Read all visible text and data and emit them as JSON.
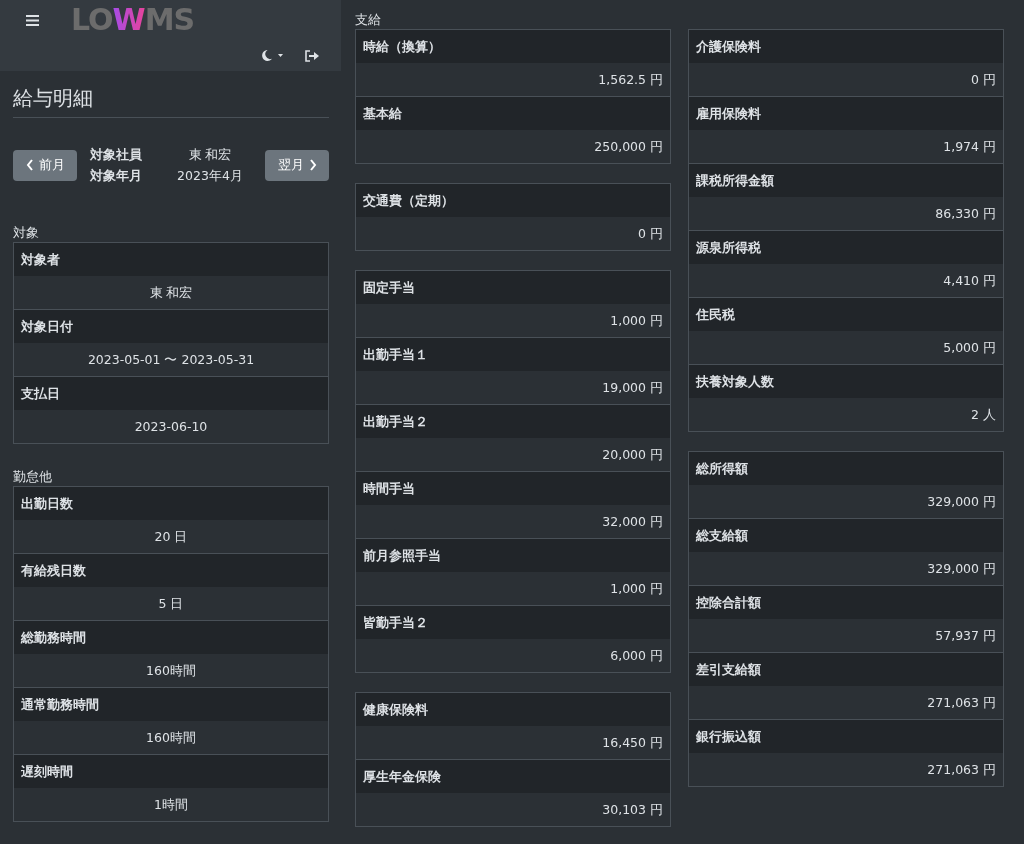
{
  "header": {
    "logo": [
      {
        "text": "LO",
        "kind": "plain"
      },
      {
        "text": "W",
        "kind": "accent"
      },
      {
        "text": "MS",
        "kind": "plain"
      }
    ]
  },
  "page": {
    "title": "給与明細",
    "prev_button": "前月",
    "next_button": "翌月",
    "meta": [
      {
        "label": "対象社員",
        "value": "東 和宏"
      },
      {
        "label": "対象年月",
        "value": "2023年4月"
      }
    ]
  },
  "columns": [
    {
      "kind": "centered",
      "sections": [
        {
          "heading": "対象",
          "boxes": [
            [
              {
                "label": "対象者",
                "value": "東 和宏"
              },
              {
                "label": "対象日付",
                "value": "2023-05-01 〜 2023-05-31"
              },
              {
                "label": "支払日",
                "value": "2023-06-10"
              }
            ]
          ]
        },
        {
          "heading": "勤怠他",
          "boxes": [
            [
              {
                "label": "出勤日数",
                "value": "20 日"
              },
              {
                "label": "有給残日数",
                "value": "5 日"
              },
              {
                "label": "総勤務時間",
                "value": "160時間"
              },
              {
                "label": "通常勤務時間",
                "value": "160時間"
              },
              {
                "label": "遅刻時間",
                "value": "1時間"
              }
            ]
          ]
        }
      ]
    },
    {
      "kind": "amounts",
      "sections": [
        {
          "heading": "支給",
          "boxes": [
            [
              {
                "label": "時給（換算）",
                "value": "1,562.5 円"
              },
              {
                "label": "基本給",
                "value": "250,000 円"
              }
            ],
            [
              {
                "label": "交通費（定期）",
                "value": "0 円"
              }
            ],
            [
              {
                "label": "固定手当",
                "value": "1,000 円"
              },
              {
                "label": "出勤手当１",
                "value": "19,000 円"
              },
              {
                "label": "出勤手当２",
                "value": "20,000 円"
              },
              {
                "label": "時間手当",
                "value": "32,000 円"
              },
              {
                "label": "前月参照手当",
                "value": "1,000 円"
              },
              {
                "label": "皆勤手当２",
                "value": "6,000 円"
              }
            ],
            [
              {
                "label": "健康保険料",
                "value": "16,450 円"
              },
              {
                "label": "厚生年金保険",
                "value": "30,103 円"
              }
            ]
          ]
        }
      ]
    },
    {
      "kind": "amounts",
      "sections": [
        {
          "boxes": [
            [
              {
                "label": "介護保険料",
                "value": "0 円"
              },
              {
                "label": "雇用保険料",
                "value": "1,974 円"
              },
              {
                "label": "課税所得金額",
                "value": "86,330 円"
              },
              {
                "label": "源泉所得税",
                "value": "4,410 円"
              },
              {
                "label": "住民税",
                "value": "5,000 円"
              },
              {
                "label": "扶養対象人数",
                "value": "2 人"
              }
            ],
            [
              {
                "label": "総所得額",
                "value": "329,000 円"
              },
              {
                "label": "総支給額",
                "value": "329,000 円"
              },
              {
                "label": "控除合計額",
                "value": "57,937 円"
              },
              {
                "label": "差引支給額",
                "value": "271,063 円"
              },
              {
                "label": "銀行振込額",
                "value": "271,063 円"
              }
            ]
          ]
        }
      ]
    }
  ]
}
